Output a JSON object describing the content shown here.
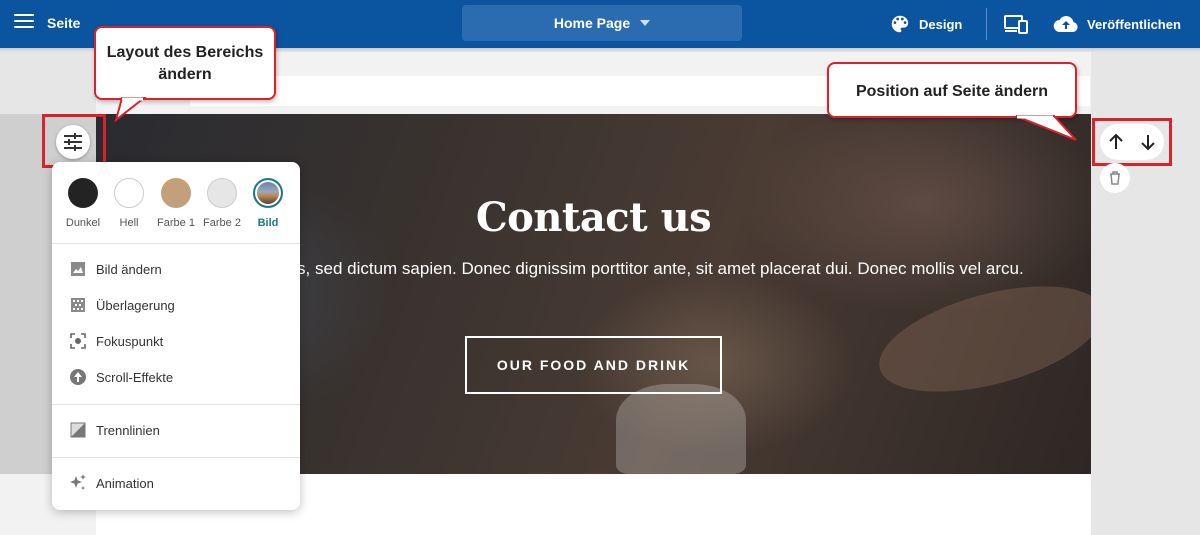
{
  "topbar": {
    "page_label": "Seite",
    "page_select": "Home Page",
    "design_label": "Design",
    "publish_label": "Veröffentlichen"
  },
  "hero": {
    "title": "Contact us",
    "text": "a eros, sed dictum sapien. Donec dignissim porttitor ante, sit amet placerat dui. Donec mollis vel arcu.",
    "button": "OUR FOOD AND DRINK"
  },
  "callouts": {
    "layout": "Layout des Bereichs ändern",
    "position": "Position auf Seite ändern"
  },
  "panel": {
    "swatches": [
      {
        "label": "Dunkel",
        "color": "#232323"
      },
      {
        "label": "Hell",
        "color": "#ffffff"
      },
      {
        "label": "Farbe 1",
        "color": "#c4a07a"
      },
      {
        "label": "Farbe 2",
        "color": "#e6e6e6"
      },
      {
        "label": "Bild",
        "color": "#3a5a7a"
      }
    ],
    "items": [
      {
        "label": "Bild ändern",
        "icon": "image-icon"
      },
      {
        "label": "Überlagerung",
        "icon": "overlay-icon"
      },
      {
        "label": "Fokuspunkt",
        "icon": "focus-icon"
      },
      {
        "label": "Scroll-Effekte",
        "icon": "scroll-effects-icon"
      },
      {
        "label": "Trennlinien",
        "icon": "divider-icon"
      },
      {
        "label": "Animation",
        "icon": "sparkle-icon"
      }
    ]
  },
  "colors": {
    "topbar": "#0b54a0",
    "highlight": "#d8232a",
    "active_swatch": "#1b7a8a"
  }
}
